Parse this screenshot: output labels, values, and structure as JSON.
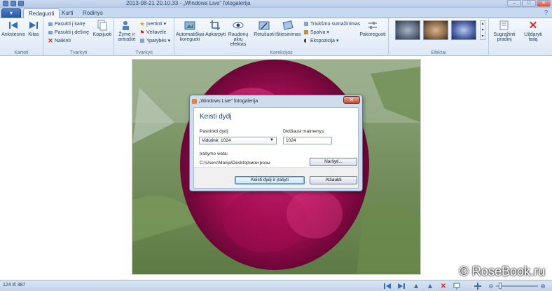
{
  "window": {
    "title": "2013-08-21 20.10.33 - „Windows Live\" fotogalerija",
    "minimize": "–",
    "maximize": "□",
    "close": "✕"
  },
  "tabs": {
    "app_menu": "▾",
    "items": [
      "Redaguoti",
      "Kurti",
      "Rodinys"
    ],
    "active": "Redaguoti"
  },
  "ribbon": {
    "groups": {
      "kartoti": {
        "label": "Kartoti",
        "buttons": [
          "Ankstesnis",
          "Kitas"
        ]
      },
      "tvarkyti": {
        "label": "Tvarkyti",
        "small": [
          "Pasukti į kairę",
          "Pasukti į dešinę",
          "Naikinti"
        ],
        "copy": "Kopijuoti"
      },
      "tvarkyti2": {
        "label": "Tvarkyti",
        "zyme": "Žymė ir antraštė",
        "small": [
          "Įvertinti",
          "Vėliavėlė",
          "Ypatybės"
        ]
      },
      "korekcijos": {
        "label": "Korekcijos",
        "buttons": [
          "Automatiškai koreguoti",
          "Apkarpyti",
          "Raudonų akių efektas",
          "Retušuoti",
          "Ištiesinimas"
        ],
        "small": [
          "Triukšmo sumažinimas",
          "Spalva",
          "Ekspozicija"
        ],
        "pakoreguoti": "Pakoreguoti"
      },
      "efektai": {
        "label": "Efektai"
      },
      "end": {
        "restore": "Sugrąžinti pradinį",
        "close": "Uždaryti failą"
      }
    }
  },
  "status": {
    "count": "124 iš 387"
  },
  "dialog": {
    "title": "„Windows Live\" fotogalerija",
    "close": "✕",
    "heading": "Keisti dydį",
    "select_label": "Pasirinkti dydį:",
    "select_value": "Vidutinė: 1024",
    "max_label": "Didžiausi matmenys:",
    "max_value": "1024",
    "save_label": "Įrašymo vieta:",
    "save_path": "C:\\Users\\Marija\\Desktop\\мои розы",
    "browse": "Naršyti...",
    "primary": "Keisti dydį ir įrašyti",
    "cancel": "Atšaukti"
  },
  "watermark": "© RoseBook.ru",
  "colors": {
    "ribbon_bg": "#dde8f5",
    "accent": "#3b7ccd",
    "rose": "#b0105a"
  }
}
